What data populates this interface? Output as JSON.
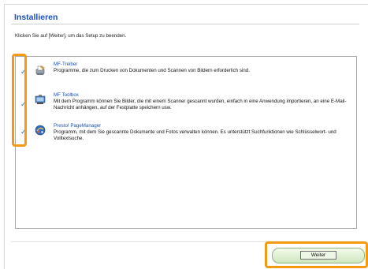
{
  "page": {
    "title": "Installieren",
    "instruction": "Klicken Sie auf [Weiter], um das Setup zu beenden."
  },
  "items": [
    {
      "name": "MF-Treiber",
      "description": "Programme, die zum Drucken von Dokumenten und Scannen von Bildern erforderlich sind.",
      "checked": true,
      "icon": "printer-driver-icon"
    },
    {
      "name": "MF Toolbox",
      "description": "Mit dem Programm können Sie Bilder, die mit einem Scanner gescannt wurden, einfach in eine Anwendung importieren, an eine E-Mail-Nachricht anhängen, auf der Festplatte speichern usw.",
      "checked": true,
      "icon": "toolbox-icon"
    },
    {
      "name": "Presto! PageManager",
      "description": "Programm, mit dem Sie gescannte Dokumente und Fotos verwalten können. Es unterstützt Suchfunktionen wie Schlüsselwort- und Volltextsuche.",
      "checked": true,
      "icon": "pagemanager-icon"
    }
  ],
  "footer": {
    "next_label": "Weiter"
  },
  "colors": {
    "title": "#1e4fb4",
    "check": "#2a6fc9",
    "highlight": "#f39a12",
    "button": "#cfe6bf"
  }
}
